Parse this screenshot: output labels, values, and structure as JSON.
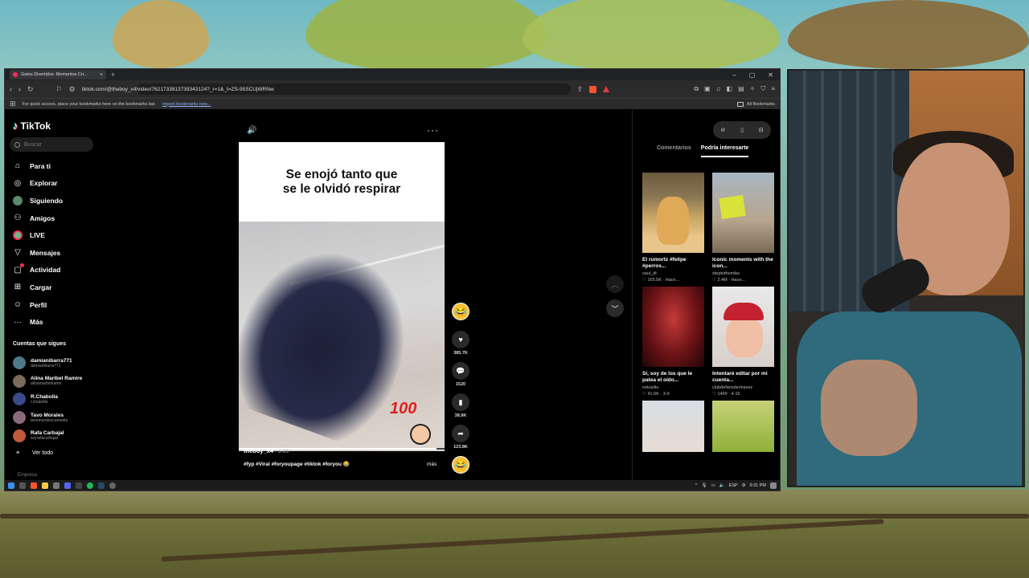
{
  "browser": {
    "tab_title": "Gatos Divertidos: Momentos Cri...",
    "url": "tiktok.com/@theboy_x4/video/7621733813739343124?_r=1&_t=ZS-95SCUjWRNw",
    "bookmarks_text": "For quick access, place your bookmarks here on the bookmarks bar.",
    "bookmarks_link": "Import bookmarks now...",
    "all_bookmarks": "All Bookmarks"
  },
  "tiktok": {
    "logo": "TikTok",
    "search_placeholder": "Buscar",
    "nav": [
      {
        "label": "Para ti",
        "icon": "home-icon"
      },
      {
        "label": "Explorar",
        "icon": "compass-icon"
      },
      {
        "label": "Siguiendo",
        "icon": "following-avatar"
      },
      {
        "label": "Amigos",
        "icon": "friends-icon"
      },
      {
        "label": "LIVE",
        "icon": "live-avatar"
      },
      {
        "label": "Mensajes",
        "icon": "send-icon"
      },
      {
        "label": "Actividad",
        "icon": "activity-icon"
      },
      {
        "label": "Cargar",
        "icon": "upload-icon"
      },
      {
        "label": "Perfil",
        "icon": "profile-icon"
      },
      {
        "label": "Más",
        "icon": "more-icon"
      }
    ],
    "following_title": "Cuentas que sigues",
    "following": [
      {
        "name": "damianibarra771",
        "handle": "damianibarra771",
        "color": "#4d7a8a"
      },
      {
        "name": "Alina Maribel Ramire",
        "handle": "alinamaribelramir",
        "color": "#7a6a5a"
      },
      {
        "name": "R.Chabolla",
        "handle": "r.chabolla",
        "color": "#3a4a8a"
      },
      {
        "name": "Tavo Morales",
        "handle": "tavomoralescomedia",
        "color": "#8a6a7a"
      },
      {
        "name": "Rafa Carbajal",
        "handle": "soyrafacarbajal",
        "color": "#c05a3a"
      }
    ],
    "see_all": "Ver todo",
    "footer": "Empresa",
    "video": {
      "caption_line1": "Se enojó tanto que",
      "caption_line2": "se le olvidó respirar",
      "sticker": "100",
      "author": "theboy_x4",
      "date": " · 3-26",
      "tags": "#fyp #Viral #foryoupage #tiktok #foryou 😂",
      "more": "más",
      "progress": 0.96
    },
    "actions": {
      "likes": "385.7K",
      "comments": "1520",
      "saves": "38.9K",
      "shares": "123.8K"
    },
    "right_panel": {
      "tabs": [
        "Comentarios",
        "Podría interesarte"
      ],
      "cards": [
        {
          "title": "El rumortz #felipe #perros...",
          "user": "saul_dt",
          "meta": "♡ 165.5K · Hace..."
        },
        {
          "title": "Iconic moments with the icon...",
          "user": "steptothemike",
          "meta": "♡ 2.4M · Hace..."
        },
        {
          "title": "Sí, soy de los que le patea el oído...",
          "user": "ostualito",
          "meta": "♡ 41.6K · 3-9"
        },
        {
          "title": "Intentaré editar por mi cuenta...",
          "user": "clubdefansdexhavez",
          "meta": "♡ 1469 · 4-16"
        },
        {
          "title": "",
          "user": "",
          "meta": ""
        },
        {
          "title": "",
          "user": "",
          "meta": ""
        }
      ]
    }
  },
  "taskbar": {
    "lang": "ESP",
    "time": "9:31 PM"
  }
}
